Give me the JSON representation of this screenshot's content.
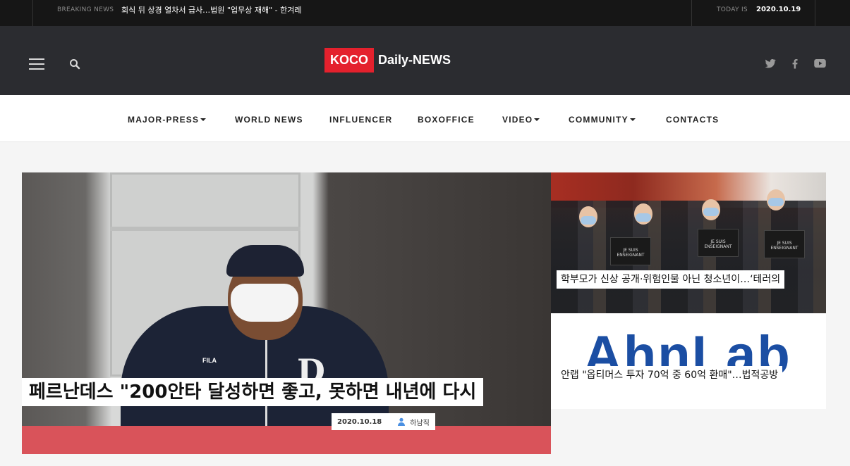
{
  "topbar": {
    "breaking_label": "BREAKING NEWS",
    "breaking_text": "회식 뒤 상경 열차서 급사…법원 \"업무상 재해\" - 한겨레",
    "today_label": "TODAY IS",
    "today_date": "2020.10.19"
  },
  "header": {
    "logo_box": "KOCO",
    "logo_text": "Daily-NEWS",
    "icons": [
      "menu-icon",
      "search-icon",
      "twitter-icon",
      "facebook-icon",
      "youtube-icon"
    ]
  },
  "nav": {
    "items": [
      {
        "label": "MAJOR-PRESS",
        "dropdown": true
      },
      {
        "label": "WORLD NEWS",
        "dropdown": false
      },
      {
        "label": "INFLUENCER",
        "dropdown": false
      },
      {
        "label": "BOXOFFICE",
        "dropdown": false
      },
      {
        "label": "VIDEO",
        "dropdown": true
      },
      {
        "label": "COMMUNITY",
        "dropdown": true
      },
      {
        "label": "CONTACTS",
        "dropdown": false
      }
    ]
  },
  "feature": {
    "title": "페르난데스 \"200안타 달성하면 좋고, 못하면 내년에 다시",
    "date": "2020.10.18",
    "author": "하남직",
    "image_text": "FILA"
  },
  "cards": [
    {
      "title": "학부모가 신상 공개·위험인물 아닌 청소년이…‘테러의",
      "sign_text": "JE SUIS ENSEIGNANT"
    },
    {
      "title": "안랩 \"옵티머스 투자 70억 중 60억 환매\"…법적공방",
      "image_text": "AhnLab"
    }
  ],
  "colors": {
    "brand_red": "#e4212d",
    "topbar_bg": "#161616",
    "header_bg": "#2b2c30"
  }
}
